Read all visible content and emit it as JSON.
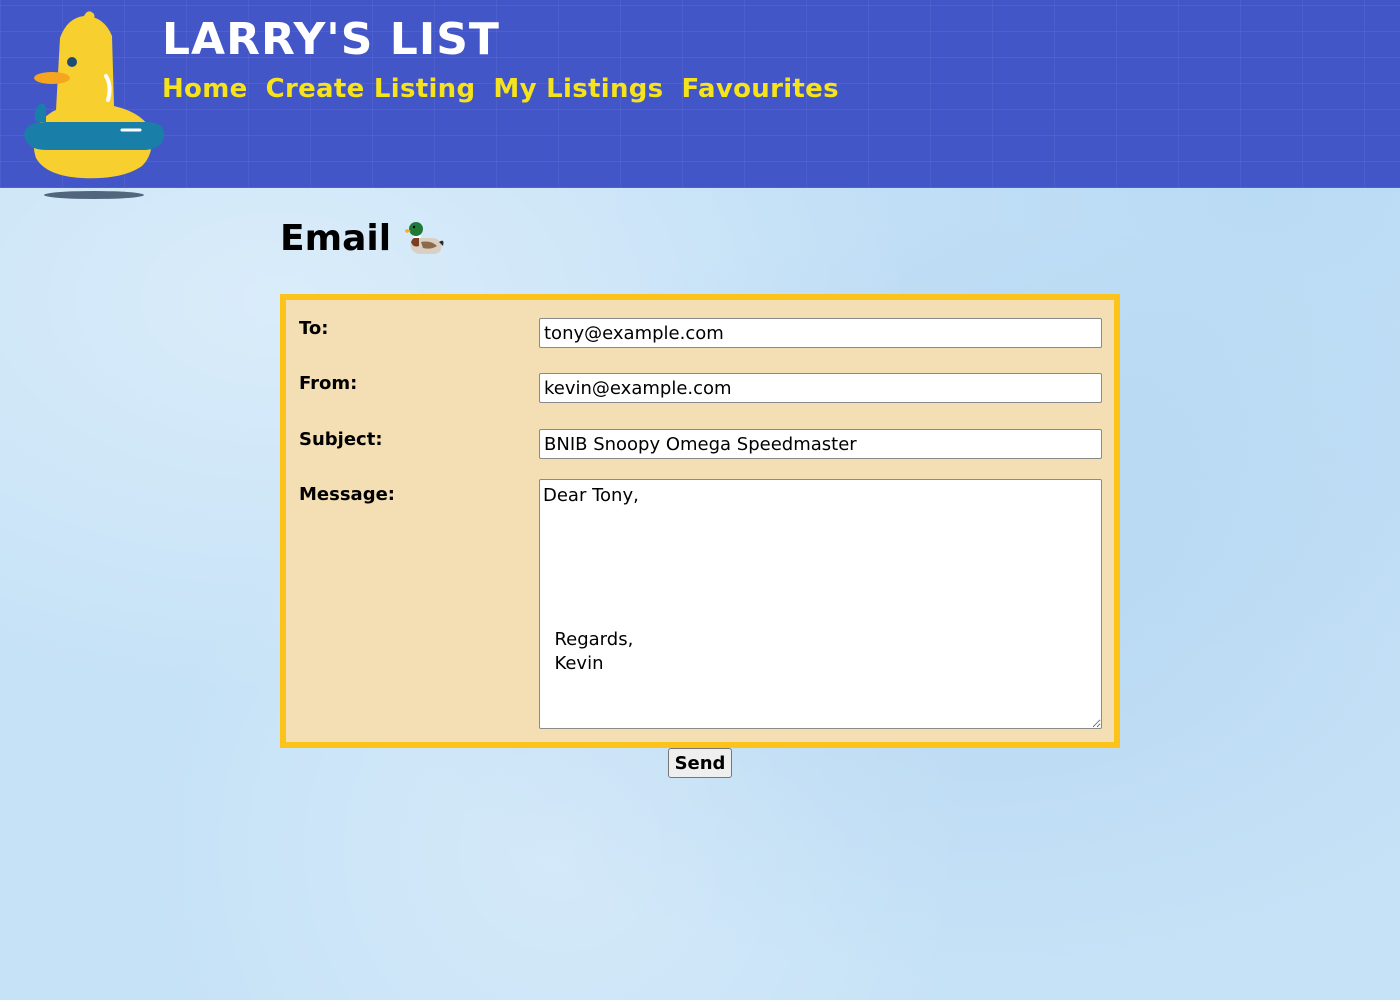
{
  "header": {
    "site_title": "LARRY'S LIST",
    "logo_icon": "rubber-duck-with-swim-ring-icon",
    "nav": [
      {
        "label": "Home"
      },
      {
        "label": "Create Listing"
      },
      {
        "label": "My Listings"
      },
      {
        "label": "Favourites"
      }
    ]
  },
  "main": {
    "title": "Email",
    "title_icon": "mallard-duck-icon"
  },
  "form": {
    "to_label": "To:",
    "to_value": "tony@example.com",
    "from_label": "From:",
    "from_value": "kevin@example.com",
    "subject_label": "Subject:",
    "subject_value": "BNIB Snoopy Omega Speedmaster",
    "message_label": "Message:",
    "message_value": "Dear Tony,\n\n\n\n\n\n  Regards,\n  Kevin",
    "send_label": "Send"
  },
  "colors": {
    "header_bg": "#4256c8",
    "site_title": "#ffffff",
    "nav_link": "#f6e31b",
    "page_bg": "#c6e2f7",
    "form_bg": "#f4dfb5",
    "form_border": "#fcc31b"
  }
}
